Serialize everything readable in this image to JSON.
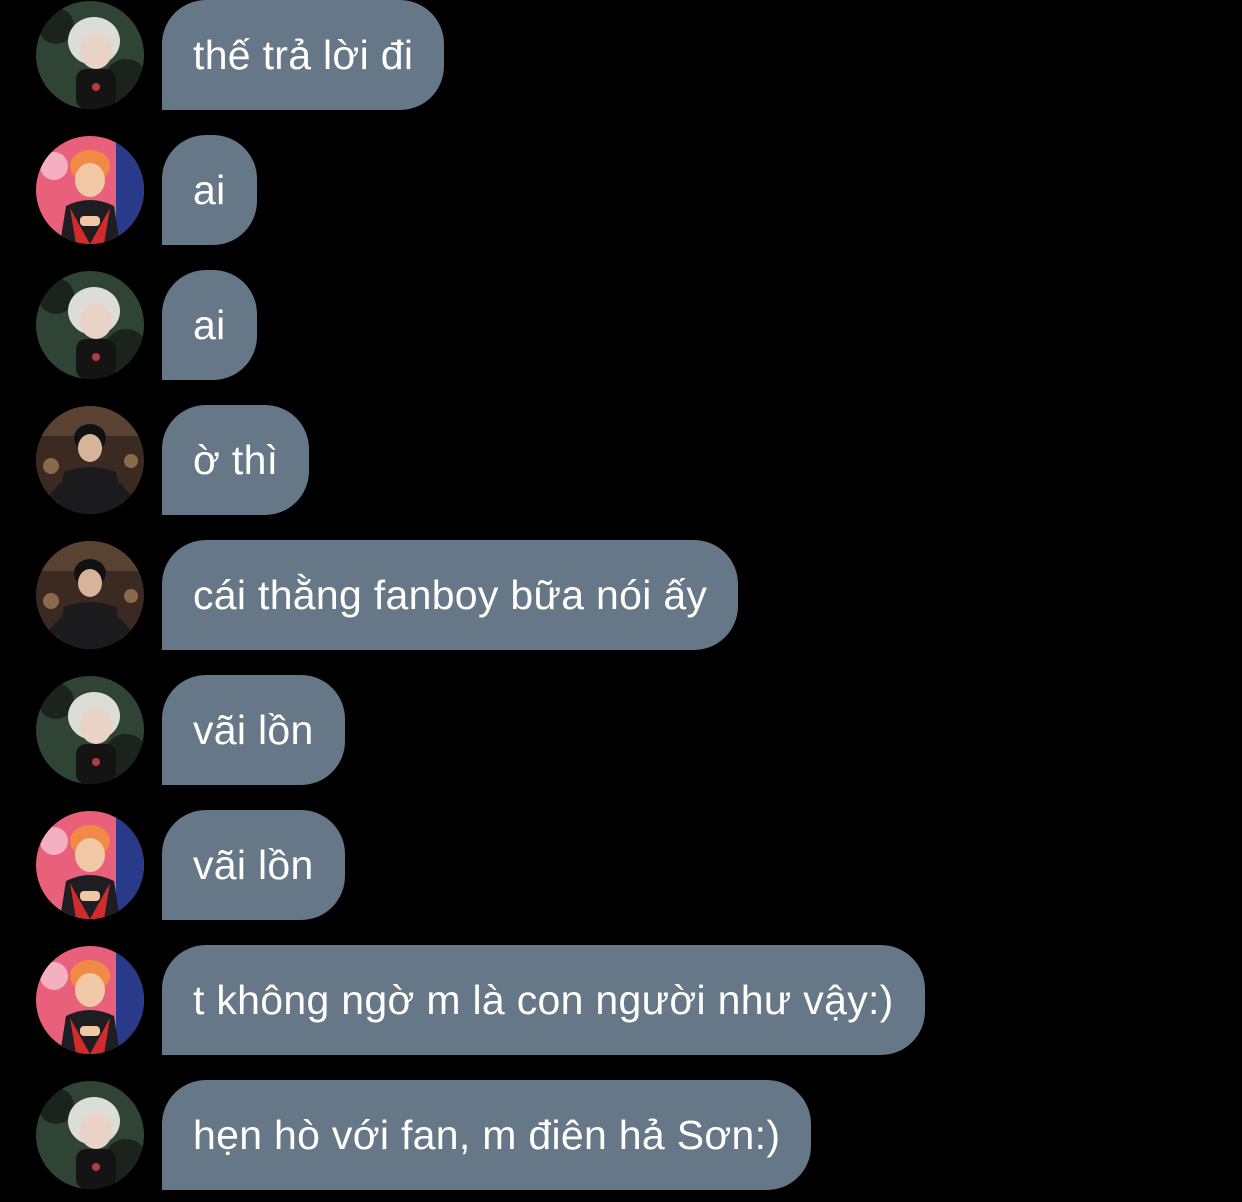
{
  "background_color": "#000000",
  "bubble_color": "#667788",
  "text_color": "#ffffff",
  "avatar_types": {
    "white_hair": {
      "icon": "avatar-white-hair-person",
      "colors": [
        "#2f4434",
        "#dcdcd8",
        "#1a231c"
      ]
    },
    "orange_hair": {
      "icon": "avatar-orange-hair-person",
      "colors": [
        "#e8607a",
        "#f08a45",
        "#d22b2b"
      ]
    },
    "dark_hair": {
      "icon": "avatar-dark-hair-person",
      "colors": [
        "#3a2a22",
        "#1b1b1d",
        "#8a6a4a"
      ]
    }
  },
  "messages": [
    {
      "avatar": "white_hair",
      "text": "thế trả lời đi"
    },
    {
      "avatar": "orange_hair",
      "text": "ai"
    },
    {
      "avatar": "white_hair",
      "text": "ai"
    },
    {
      "avatar": "dark_hair",
      "text": "ờ thì"
    },
    {
      "avatar": "dark_hair",
      "text": "cái thằng fanboy bữa nói ấy"
    },
    {
      "avatar": "white_hair",
      "text": "vãi lồn"
    },
    {
      "avatar": "orange_hair",
      "text": "vãi lồn"
    },
    {
      "avatar": "orange_hair",
      "text": "t không ngờ m là con người như vậy:)"
    },
    {
      "avatar": "white_hair",
      "text": "hẹn hò với fan, m điên hả Sơn:)"
    }
  ]
}
